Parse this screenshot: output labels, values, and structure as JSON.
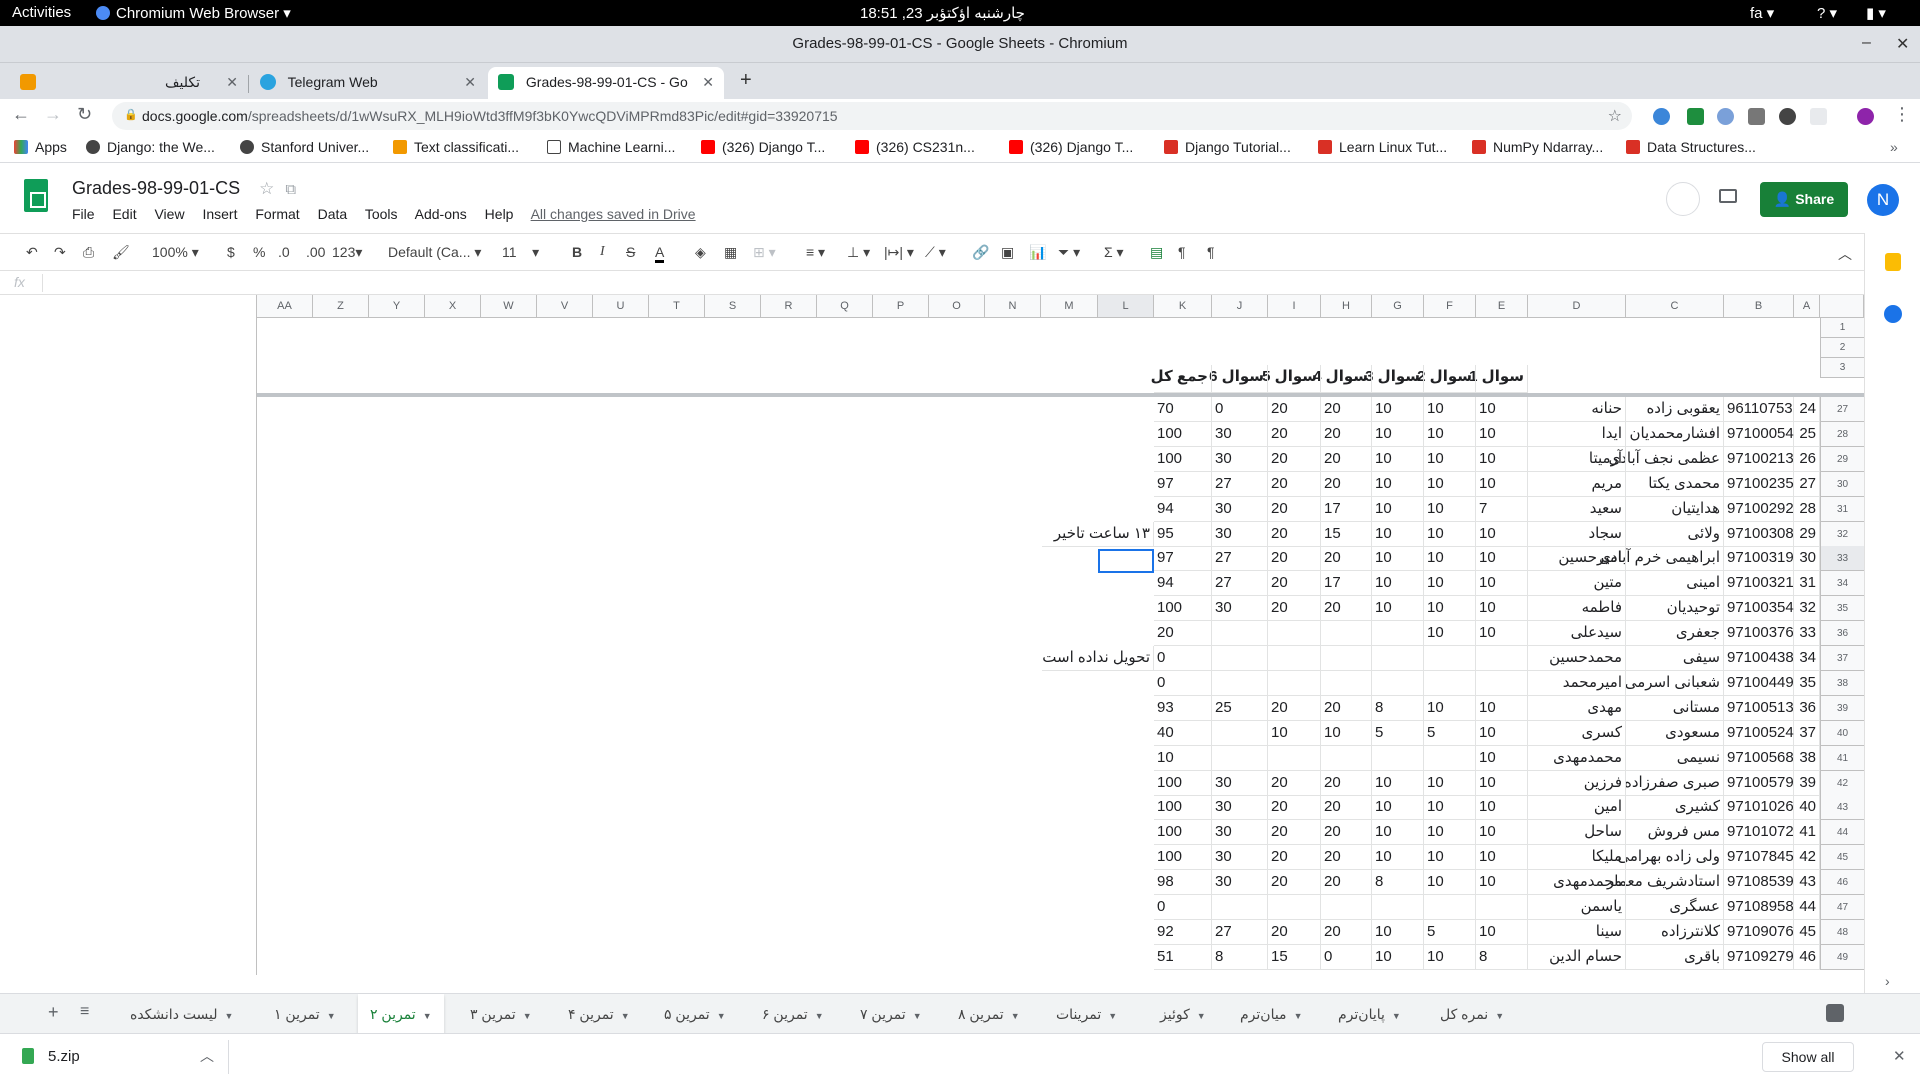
{
  "system": {
    "activities": "Activities",
    "app_name": "Chromium Web Browser",
    "clock": "چارشنبه اؤکتؤبر 23, 18:51",
    "lang": "fa"
  },
  "window": {
    "title": "Grades-98-99-01-CS - Google Sheets - Chromium"
  },
  "tabs": [
    {
      "label": "تکلیف"
    },
    {
      "label": "Telegram Web"
    },
    {
      "label": "Grades-98-99-01-CS - Go"
    }
  ],
  "omnibox": {
    "url_host": "docs.google.com",
    "url_path": "/spreadsheets/d/1wWsuRX_MLH9ioWtd3ffM9f3bK0YwcQDViMPRmd83Pic/edit#gid=33920715"
  },
  "bookmarks": [
    "Apps",
    "Django: the We...",
    "Stanford Univer...",
    "Text classificati...",
    "Machine Learni...",
    "(326) Django T...",
    "(326) CS231n...",
    "(326) Django T...",
    "Django Tutorial...",
    "Learn Linux Tut...",
    "NumPy Ndarray...",
    "Data Structures..."
  ],
  "sheet": {
    "title": "Grades-98-99-01-CS",
    "menu": [
      "File",
      "Edit",
      "View",
      "Insert",
      "Format",
      "Data",
      "Tools",
      "Add-ons",
      "Help"
    ],
    "saved_status": "All changes saved in Drive",
    "share_label": "Share",
    "avatar_letter": "N"
  },
  "toolbar": {
    "zoom": "100%",
    "currency": "$",
    "percent": "%",
    "dec_less": ".0",
    "dec_more": ".00",
    "format_more": "123",
    "font": "Default (Ca...",
    "font_size": "11"
  },
  "formula": {
    "fx": "fx",
    "value": ""
  },
  "columns": [
    "AA",
    "Z",
    "Y",
    "X",
    "W",
    "V",
    "U",
    "T",
    "S",
    "R",
    "Q",
    "P",
    "O",
    "N",
    "M",
    "L",
    "K",
    "J",
    "I",
    "H",
    "G",
    "F",
    "E",
    "D",
    "C",
    "B",
    "A"
  ],
  "header_row": [
    "سوال 1",
    "سوال 2",
    "سوال 3",
    "سوال 4",
    "سوال 5",
    "سوال 6",
    "جمع کل"
  ],
  "rows": [
    {
      "r": "27",
      "a": "24",
      "b": "96110753",
      "c": "یعقوبی زاده",
      "d": "حنانه",
      "e": "10",
      "f": "10",
      "g": "10",
      "h": "20",
      "i": "20",
      "j": "0",
      "k": "70",
      "note": ""
    },
    {
      "r": "28",
      "a": "25",
      "b": "97100054",
      "c": "افشارمحمدیان",
      "d": "ایدا",
      "e": "10",
      "f": "10",
      "g": "10",
      "h": "20",
      "i": "20",
      "j": "30",
      "k": "100",
      "note": ""
    },
    {
      "r": "29",
      "a": "26",
      "b": "97100213",
      "c": "عظمی نجف آبادی",
      "d": "آرمیتا",
      "e": "10",
      "f": "10",
      "g": "10",
      "h": "20",
      "i": "20",
      "j": "30",
      "k": "100",
      "note": ""
    },
    {
      "r": "30",
      "a": "27",
      "b": "97100235",
      "c": "محمدی یکتا",
      "d": "مریم",
      "e": "10",
      "f": "10",
      "g": "10",
      "h": "20",
      "i": "20",
      "j": "27",
      "k": "97",
      "note": ""
    },
    {
      "r": "31",
      "a": "28",
      "b": "97100292",
      "c": "هدایتیان",
      "d": "سعید",
      "e": "7",
      "f": "10",
      "g": "10",
      "h": "17",
      "i": "20",
      "j": "30",
      "k": "94",
      "note": ""
    },
    {
      "r": "32",
      "a": "29",
      "b": "97100308",
      "c": "ولائی",
      "d": "سجاد",
      "e": "10",
      "f": "10",
      "g": "10",
      "h": "15",
      "i": "20",
      "j": "30",
      "k": "95",
      "note": "۱۳ ساعت تاخیر"
    },
    {
      "r": "33",
      "a": "30",
      "b": "97100319",
      "c": "ابراهیمی خرم آبادی",
      "d": "امیرحسین",
      "e": "10",
      "f": "10",
      "g": "10",
      "h": "20",
      "i": "20",
      "j": "27",
      "k": "97",
      "note": ""
    },
    {
      "r": "34",
      "a": "31",
      "b": "97100321",
      "c": "امینی",
      "d": "متین",
      "e": "10",
      "f": "10",
      "g": "10",
      "h": "17",
      "i": "20",
      "j": "27",
      "k": "94",
      "note": ""
    },
    {
      "r": "35",
      "a": "32",
      "b": "97100354",
      "c": "توحیدیان",
      "d": "فاطمه",
      "e": "10",
      "f": "10",
      "g": "10",
      "h": "20",
      "i": "20",
      "j": "30",
      "k": "100",
      "note": ""
    },
    {
      "r": "36",
      "a": "33",
      "b": "97100376",
      "c": "جعفری",
      "d": "سیدعلی",
      "e": "10",
      "f": "10",
      "g": "",
      "h": "",
      "i": "",
      "j": "",
      "k": "20",
      "note": ""
    },
    {
      "r": "37",
      "a": "34",
      "b": "97100438",
      "c": "سیفی",
      "d": "محمدحسین",
      "e": "",
      "f": "",
      "g": "",
      "h": "",
      "i": "",
      "j": "",
      "k": "0",
      "note": "تحویل نداده است"
    },
    {
      "r": "38",
      "a": "35",
      "b": "97100449",
      "c": "شعبانی اسرمی",
      "d": "امیرمحمد",
      "e": "",
      "f": "",
      "g": "",
      "h": "",
      "i": "",
      "j": "",
      "k": "0",
      "note": ""
    },
    {
      "r": "39",
      "a": "36",
      "b": "97100513",
      "c": "مستانی",
      "d": "مهدی",
      "e": "10",
      "f": "10",
      "g": "8",
      "h": "20",
      "i": "20",
      "j": "25",
      "k": "93",
      "note": ""
    },
    {
      "r": "40",
      "a": "37",
      "b": "97100524",
      "c": "مسعودی",
      "d": "کسری",
      "e": "10",
      "f": "5",
      "g": "5",
      "h": "10",
      "i": "10",
      "j": "",
      "k": "40",
      "note": ""
    },
    {
      "r": "41",
      "a": "38",
      "b": "97100568",
      "c": "نسیمی",
      "d": "محمدمهدی",
      "e": "10",
      "f": "",
      "g": "",
      "h": "",
      "i": "",
      "j": "",
      "k": "10",
      "note": ""
    },
    {
      "r": "42",
      "a": "39",
      "b": "97100579",
      "c": "صبری صفرزاده",
      "d": "فرزین",
      "e": "10",
      "f": "10",
      "g": "10",
      "h": "20",
      "i": "20",
      "j": "30",
      "k": "100",
      "note": ""
    },
    {
      "r": "43",
      "a": "40",
      "b": "97101026",
      "c": "کشیری",
      "d": "امین",
      "e": "10",
      "f": "10",
      "g": "10",
      "h": "20",
      "i": "20",
      "j": "30",
      "k": "100",
      "note": ""
    },
    {
      "r": "44",
      "a": "41",
      "b": "97101072",
      "c": "مس فروش",
      "d": "ساحل",
      "e": "10",
      "f": "10",
      "g": "10",
      "h": "20",
      "i": "20",
      "j": "30",
      "k": "100",
      "note": ""
    },
    {
      "r": "45",
      "a": "42",
      "b": "97107845",
      "c": "ولی زاده بهرامی",
      "d": "ملیکا",
      "e": "10",
      "f": "10",
      "g": "10",
      "h": "20",
      "i": "20",
      "j": "30",
      "k": "100",
      "note": ""
    },
    {
      "r": "46",
      "a": "43",
      "b": "97108539",
      "c": "استادشریف معمار",
      "d": "محمدمهدی",
      "e": "10",
      "f": "10",
      "g": "8",
      "h": "20",
      "i": "20",
      "j": "30",
      "k": "98",
      "note": ""
    },
    {
      "r": "47",
      "a": "44",
      "b": "97108958",
      "c": "عسگری",
      "d": "یاسمن",
      "e": "",
      "f": "",
      "g": "",
      "h": "",
      "i": "",
      "j": "",
      "k": "0",
      "note": ""
    },
    {
      "r": "48",
      "a": "45",
      "b": "97109076",
      "c": "کلانترزاده",
      "d": "سینا",
      "e": "10",
      "f": "5",
      "g": "10",
      "h": "20",
      "i": "20",
      "j": "27",
      "k": "92",
      "note": ""
    },
    {
      "r": "49",
      "a": "46",
      "b": "97109279",
      "c": "باقری",
      "d": "حسام الدین",
      "e": "8",
      "f": "10",
      "g": "10",
      "h": "0",
      "i": "15",
      "j": "8",
      "k": "51",
      "note": ""
    }
  ],
  "sheet_tabs": [
    "لیست دانشکده",
    "تمرین ۱",
    "تمرین ۲",
    "تمرین ۳",
    "تمرین ۴",
    "تمرین ۵",
    "تمرین ۶",
    "تمرین ۷",
    "تمرین ۸",
    "تمرینات",
    "کوئیز",
    "میان‌ترم",
    "پایان‌ترم",
    "نمره کل"
  ],
  "download": {
    "file": "5.zip",
    "show_all": "Show all"
  }
}
